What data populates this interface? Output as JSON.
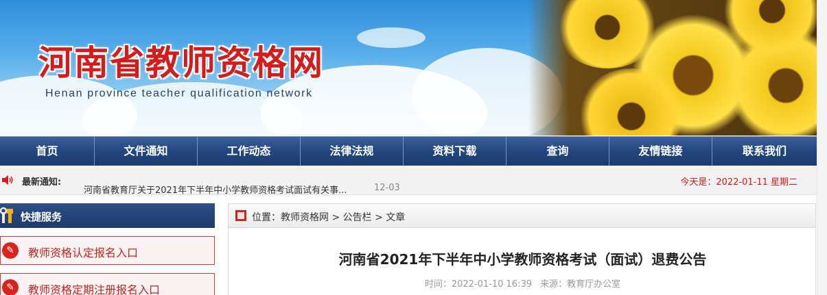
{
  "banner": {
    "title": "河南省教师资格网",
    "subtitle": "Henan province teacher qualification network"
  },
  "nav": {
    "items": [
      {
        "label": "首页"
      },
      {
        "label": "文件通知"
      },
      {
        "label": "工作动态"
      },
      {
        "label": "法律法规"
      },
      {
        "label": "资料下载"
      },
      {
        "label": "查询"
      },
      {
        "label": "友情链接"
      },
      {
        "label": "联系我们"
      }
    ]
  },
  "notice": {
    "label": "最新通知:",
    "text": "河南省教育厅关于2021年下半年中小学教师资格考试面试有关事...",
    "date": "12-03",
    "today": "今天是：2022-01-11  星期二"
  },
  "sidebar": {
    "heading": "快捷服务",
    "links": [
      {
        "label": "教师资格认定报名入口"
      },
      {
        "label": "教师资格定期注册报名入口"
      }
    ]
  },
  "breadcrumb": {
    "text": "位置：教师资格网 > 公告栏 > 文章"
  },
  "article": {
    "title": "河南省2021年下半年中小学教师资格考试（面试）退费公告",
    "time": "时间：2022-01-10 16:39",
    "source": "来源：教育厅办公室"
  },
  "colors": {
    "brand_red": "#d31c1c",
    "nav_blue": "#24467f",
    "sidebar_head": "#2c4f86"
  },
  "icons": {
    "notice": "speaker-icon",
    "sidebar_head": "wrench-icon",
    "sidebar_link": "pen-icon",
    "breadcrumb": "square-marker-icon"
  }
}
